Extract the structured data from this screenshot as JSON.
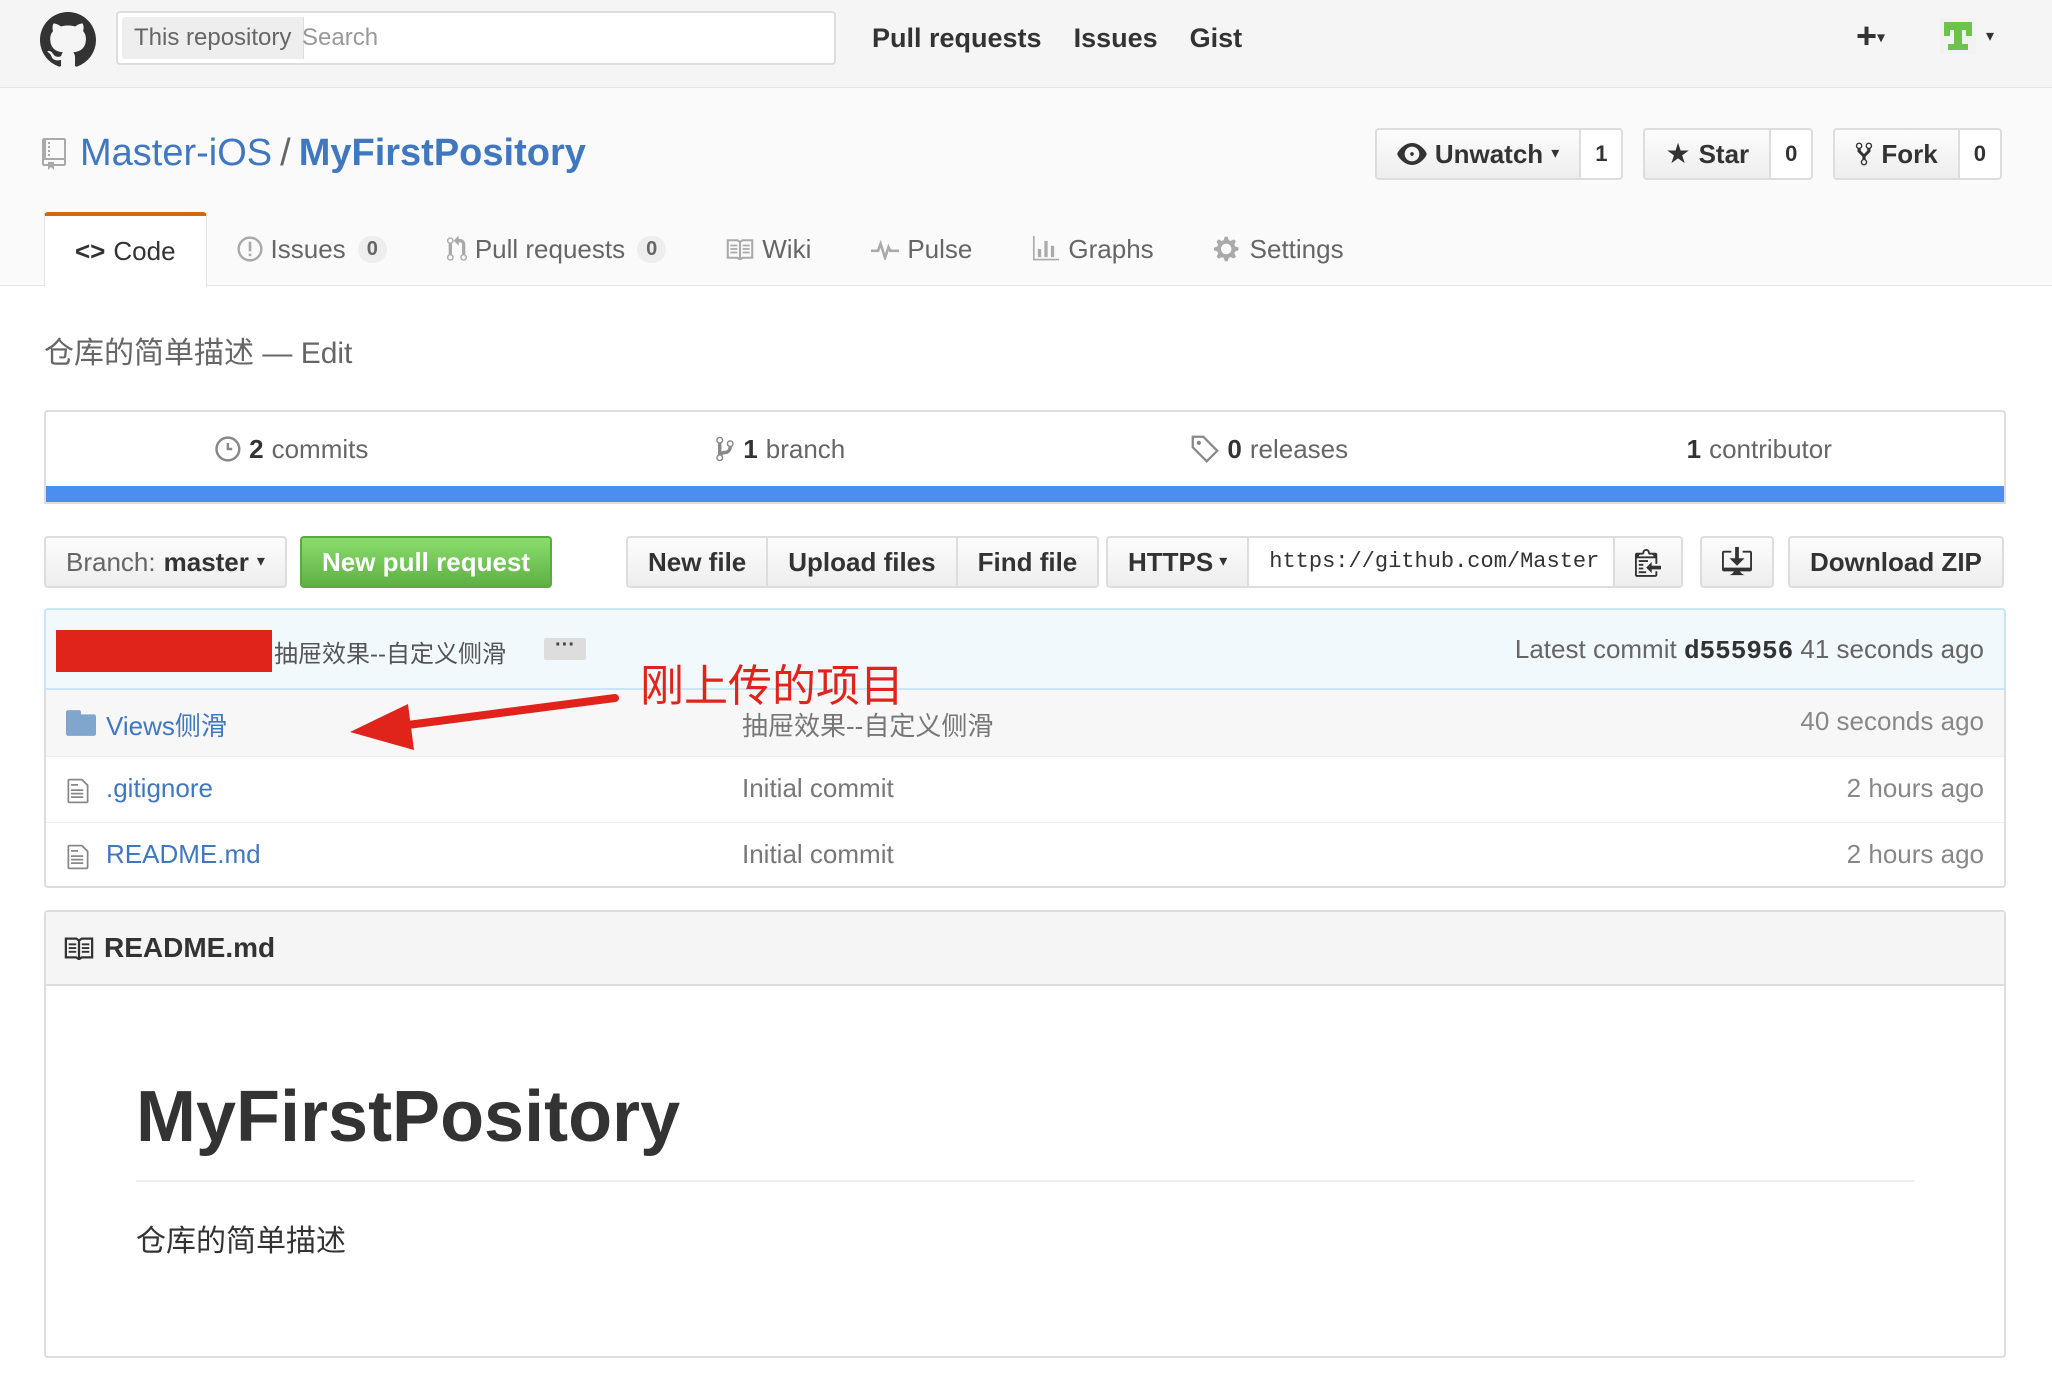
{
  "header": {
    "search_scope": "This repository",
    "search_placeholder": "Search",
    "nav": [
      "Pull requests",
      "Issues",
      "Gist"
    ],
    "plus_label": "+"
  },
  "repo": {
    "owner": "Master-iOS",
    "separator": "/",
    "name": "MyFirstPository",
    "actions": {
      "watch_label": "Unwatch",
      "watch_count": "1",
      "star_label": "Star",
      "star_count": "0",
      "fork_label": "Fork",
      "fork_count": "0"
    },
    "tabs": [
      {
        "label": "Code"
      },
      {
        "label": "Issues",
        "count": "0"
      },
      {
        "label": "Pull requests",
        "count": "0"
      },
      {
        "label": "Wiki"
      },
      {
        "label": "Pulse"
      },
      {
        "label": "Graphs"
      },
      {
        "label": "Settings"
      }
    ],
    "description": "仓库的简单描述",
    "description_sep": "—",
    "edit_label": "Edit"
  },
  "summary": {
    "commits_num": "2",
    "commits_label": "commits",
    "branch_num": "1",
    "branch_label": "branch",
    "releases_num": "0",
    "releases_label": "releases",
    "contributor_num": "1",
    "contributor_label": "contributor"
  },
  "file_nav": {
    "branch_prefix": "Branch:",
    "branch_name": "master",
    "new_pr": "New pull request",
    "new_file": "New file",
    "upload_files": "Upload files",
    "find_file": "Find file",
    "protocol": "HTTPS",
    "clone_url": "https://github.com/Master",
    "download_zip": "Download ZIP"
  },
  "latest_commit": {
    "message": "抽屉效果--自定义侧滑",
    "ellipsis": "···",
    "prefix": "Latest commit",
    "sha": "d555956",
    "age": "41 seconds ago"
  },
  "files": [
    {
      "name": "Views侧滑",
      "message": "抽屉效果--自定义侧滑",
      "age": "40 seconds ago",
      "type": "folder"
    },
    {
      "name": ".gitignore",
      "message": "Initial commit",
      "age": "2 hours ago",
      "type": "file"
    },
    {
      "name": "README.md",
      "message": "Initial commit",
      "age": "2 hours ago",
      "type": "file"
    }
  ],
  "annotation": {
    "text": "刚上传的项目",
    "color": "#e0241b"
  },
  "readme": {
    "filename": "README.md",
    "heading": "MyFirstPository",
    "body": "仓库的简单描述"
  },
  "colors": {
    "link": "#4078c0",
    "primary_button": "#60b044",
    "tab_accent": "#d26911",
    "language_bar": "#4a8ff0"
  }
}
